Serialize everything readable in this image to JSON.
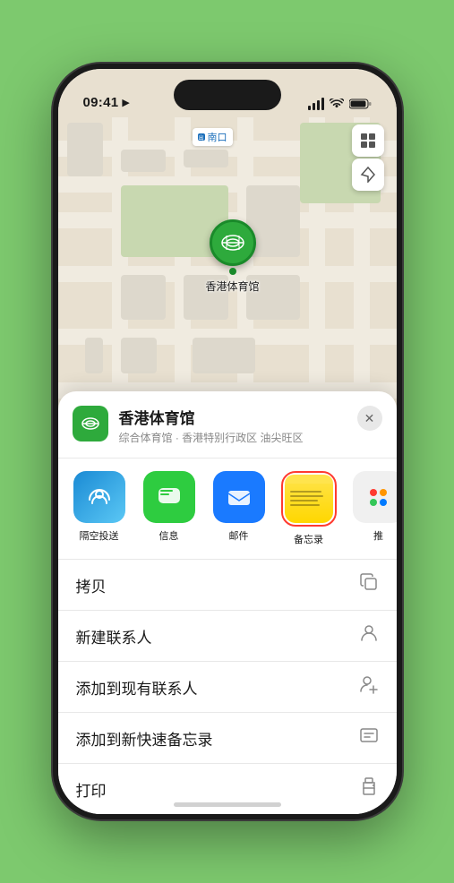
{
  "statusBar": {
    "time": "09:41",
    "timeArrow": "▶"
  },
  "map": {
    "labelText": "南口",
    "controlMap": "🗺",
    "controlLocation": "➤",
    "stadiumEmoji": "🏟",
    "stadiumLabel": "香港体育馆"
  },
  "locationCard": {
    "name": "香港体育馆",
    "subtitle": "综合体育馆 · 香港特别行政区 油尖旺区",
    "closeLabel": "✕"
  },
  "shareActions": [
    {
      "id": "airdrop",
      "label": "隔空投送"
    },
    {
      "id": "message",
      "label": "信息"
    },
    {
      "id": "mail",
      "label": "邮件"
    },
    {
      "id": "notes",
      "label": "备忘录"
    },
    {
      "id": "more",
      "label": "推"
    }
  ],
  "actionList": [
    {
      "label": "拷贝",
      "icon": "copy"
    },
    {
      "label": "新建联系人",
      "icon": "person"
    },
    {
      "label": "添加到现有联系人",
      "icon": "person-add"
    },
    {
      "label": "添加到新快速备忘录",
      "icon": "memo"
    },
    {
      "label": "打印",
      "icon": "print"
    }
  ]
}
